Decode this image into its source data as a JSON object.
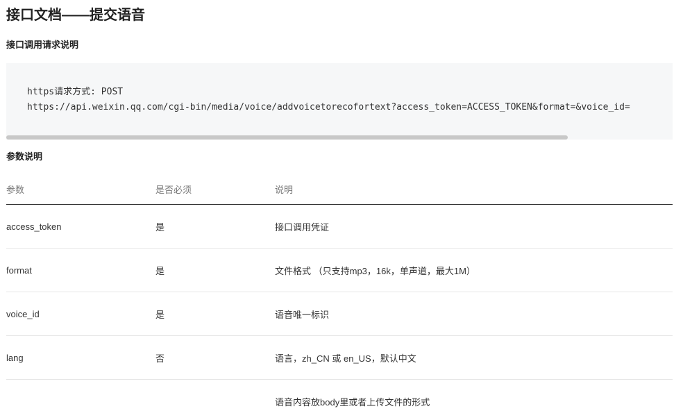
{
  "title": "接口文档——提交语音",
  "request": {
    "heading": "接口调用请求说明",
    "method_line": "https请求方式: POST",
    "url_line": "https://api.weixin.qq.com/cgi-bin/media/voice/addvoicetorecofortext?access_token=ACCESS_TOKEN&format=&voice_id="
  },
  "params": {
    "heading": "参数说明",
    "columns": [
      "参数",
      "是否必须",
      "说明"
    ],
    "rows": [
      [
        "access_token",
        "是",
        "接口调用凭证"
      ],
      [
        "format",
        "是",
        "文件格式 （只支持mp3，16k，单声道，最大1M）"
      ],
      [
        "voice_id",
        "是",
        "语音唯一标识"
      ],
      [
        "lang",
        "否",
        "语言，zh_CN 或 en_US，默认中文"
      ],
      [
        "",
        "",
        "语音内容放body里或者上传文件的形式"
      ]
    ]
  }
}
